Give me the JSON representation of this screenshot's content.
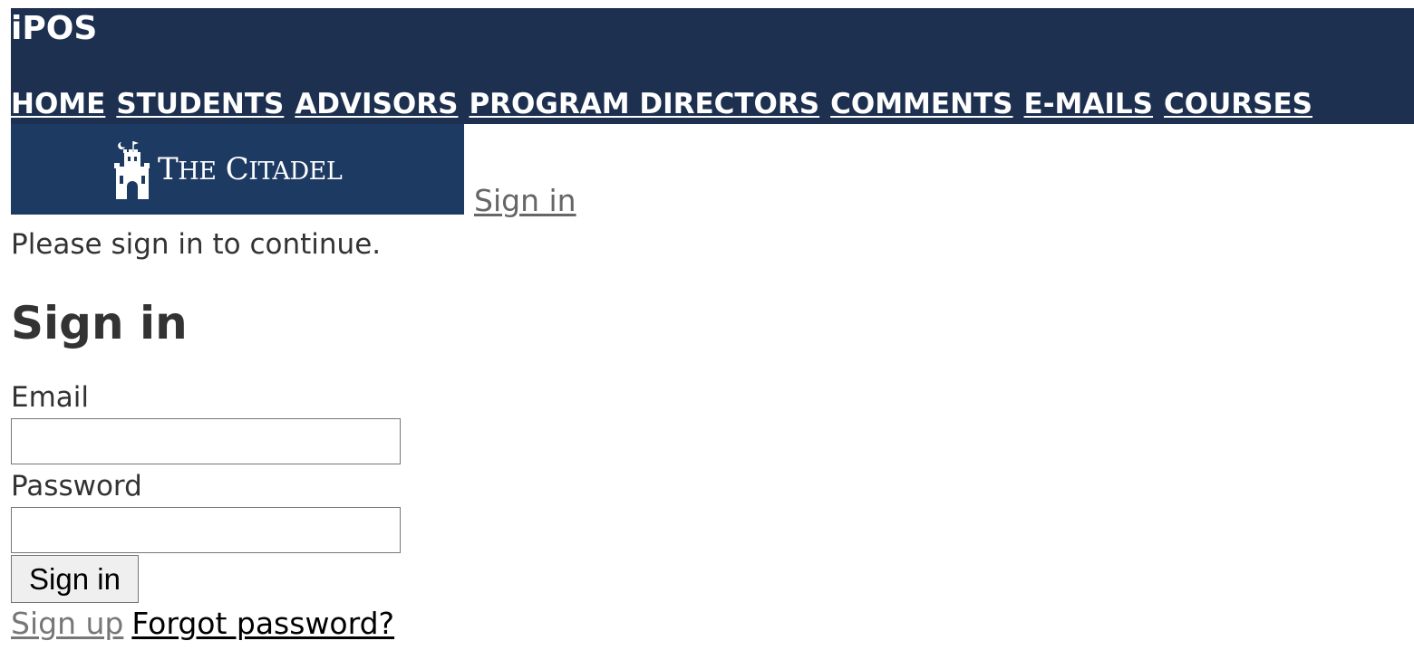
{
  "header": {
    "brand": "iPOS",
    "nav": [
      {
        "label": "HOME"
      },
      {
        "label": "STUDENTS"
      },
      {
        "label": "ADVISORS"
      },
      {
        "label": "PROGRAM DIRECTORS"
      },
      {
        "label": "COMMENTS"
      },
      {
        "label": "E-MAILS"
      },
      {
        "label": "COURSES"
      }
    ],
    "background_color": "#1d3050"
  },
  "logo": {
    "icon": "castle-icon",
    "text_first_cap": "T",
    "text_first_rest": "HE",
    "text_second_cap": "C",
    "text_second_rest": "ITADEL",
    "background_color": "#1d3a63"
  },
  "top_signin_link": "Sign in",
  "notice": "Please sign in to continue.",
  "form": {
    "title": "Sign in",
    "email_label": "Email",
    "email_value": "",
    "password_label": "Password",
    "password_value": "",
    "submit_label": "Sign in"
  },
  "footer": {
    "signup_link": "Sign up",
    "forgot_link": "Forgot password?"
  }
}
